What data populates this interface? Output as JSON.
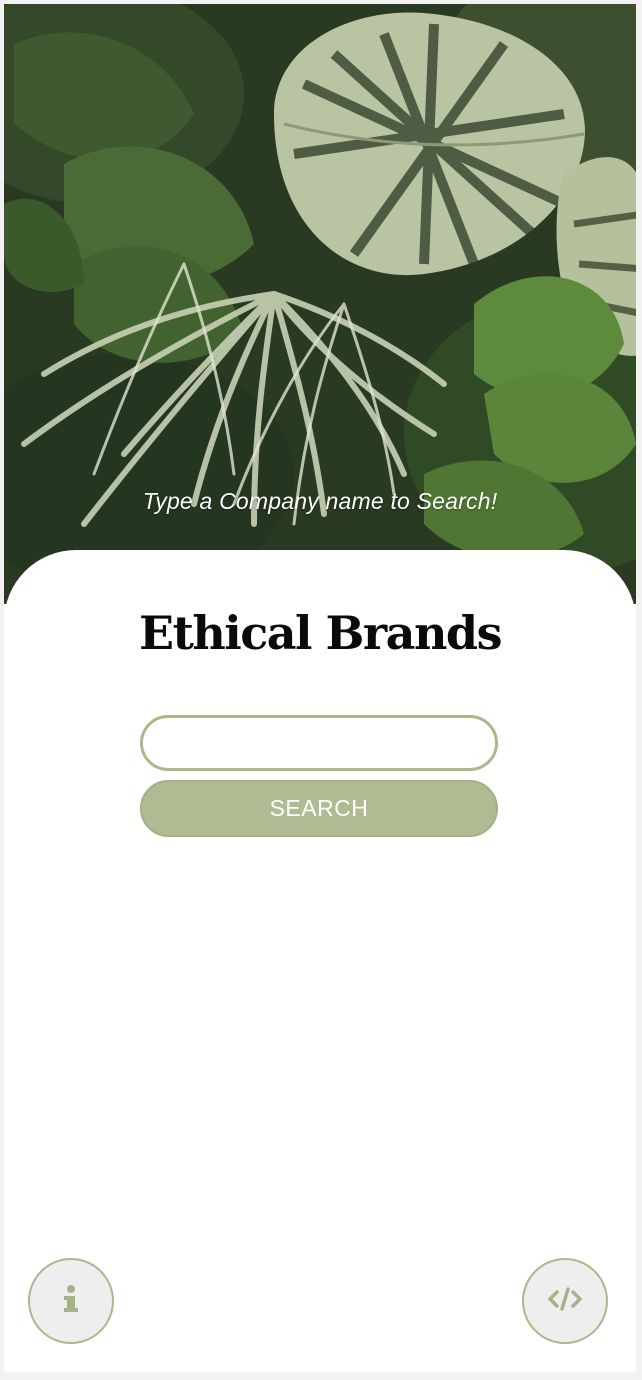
{
  "hero": {
    "caption": "Type a Company name to Search!",
    "image": "tropical-leaves-background"
  },
  "main": {
    "title": "Ethical Brands",
    "search": {
      "value": "",
      "placeholder": "",
      "button_label": "SEARCH"
    }
  },
  "footer": {
    "info_icon": "info-icon",
    "code_icon": "code-icon"
  },
  "colors": {
    "accent": "#b0bb93",
    "accent_border": "#aab88c",
    "icon": "#a6b287",
    "title": "#0a0a0a",
    "caption": "#ffffff"
  }
}
